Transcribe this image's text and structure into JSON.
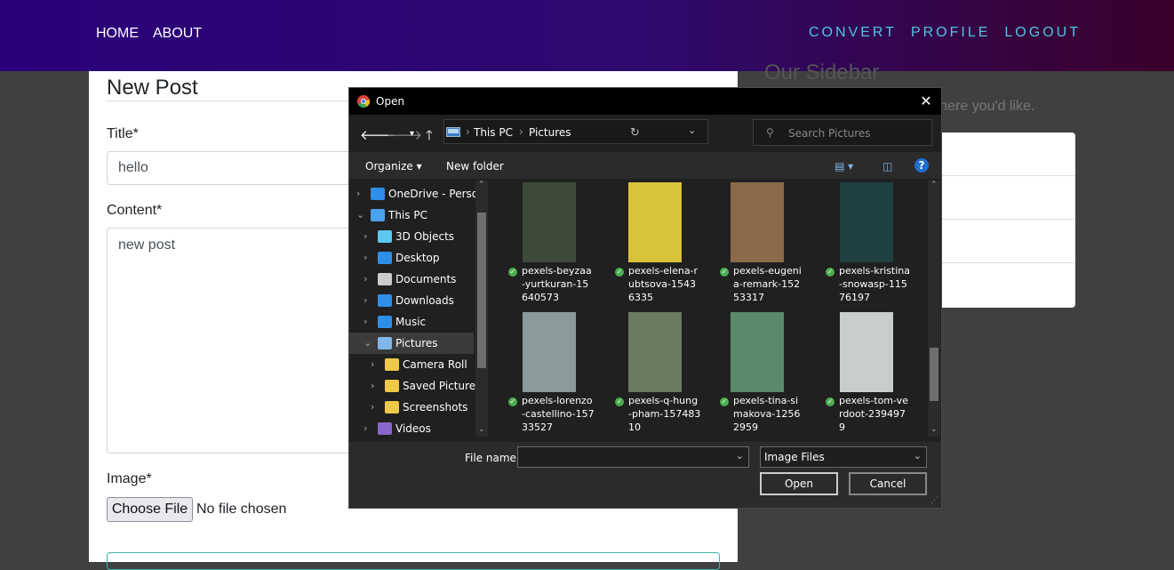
{
  "nav": {
    "left": [
      "HOME",
      "ABOUT"
    ],
    "right": [
      "CONVERT",
      "PROFILE",
      "LOGOUT"
    ]
  },
  "form": {
    "heading": "New Post",
    "title_label": "Title*",
    "title_value": "hello",
    "content_label": "Content*",
    "content_value": "new post",
    "image_label": "Image*",
    "choose_file": "Choose File",
    "no_file": "No file chosen"
  },
  "sidebar": {
    "title": "Our Sidebar",
    "text": "on here you'd like."
  },
  "dialog": {
    "title": "Open",
    "breadcrumb": [
      "This PC",
      "Pictures"
    ],
    "search_placeholder": "Search Pictures",
    "organize": "Organize",
    "new_folder": "New folder",
    "tree": [
      {
        "label": "OneDrive - Persor",
        "icon": "onedrive-icon"
      },
      {
        "label": "This PC",
        "icon": "pc-icon"
      },
      {
        "label": "3D Objects",
        "icon": "cube-icon"
      },
      {
        "label": "Desktop",
        "icon": "desktop-icon"
      },
      {
        "label": "Documents",
        "icon": "document-icon"
      },
      {
        "label": "Downloads",
        "icon": "download-icon"
      },
      {
        "label": "Music",
        "icon": "music-icon"
      },
      {
        "label": "Pictures",
        "icon": "pictures-icon",
        "selected": true
      },
      {
        "label": "Camera Roll",
        "icon": "folder-icon"
      },
      {
        "label": "Saved Pictures",
        "icon": "folder-icon"
      },
      {
        "label": "Screenshots",
        "icon": "folder-icon"
      },
      {
        "label": "Videos",
        "icon": "video-icon"
      }
    ],
    "files": [
      {
        "name": "pexels-beyzaa-yurtkuran-15640573",
        "color": "#3d4a3a"
      },
      {
        "name": "pexels-elena-rubtsova-15436335",
        "color": "#d8c23a"
      },
      {
        "name": "pexels-eugenia-remark-15253317",
        "color": "#8a6a4a"
      },
      {
        "name": "pexels-kristina-snowasp-11576197",
        "color": "#1f3f40"
      },
      {
        "name": "pexels-lorenzo-castellino-15733527",
        "color": "#8a9a9a"
      },
      {
        "name": "pexels-q-hung-pham-15748310",
        "color": "#6a7a60"
      },
      {
        "name": "pexels-tina-simakova-12562959",
        "color": "#5a8a6a"
      },
      {
        "name": "pexels-tom-verdoot-2394979",
        "color": "#c8cccc"
      }
    ],
    "file_name_label": "File name:",
    "file_name_value": "",
    "file_type": "Image Files",
    "open_button": "Open",
    "cancel_button": "Cancel"
  }
}
